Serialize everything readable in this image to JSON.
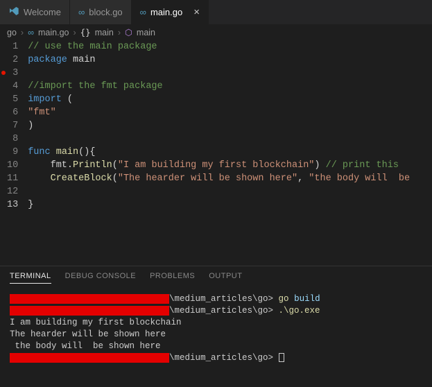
{
  "tabs": [
    {
      "label": "Welcome",
      "type": "vs"
    },
    {
      "label": "block.go",
      "type": "go"
    },
    {
      "label": "main.go",
      "type": "go",
      "active": true,
      "closable": true
    }
  ],
  "breadcrumb": {
    "root": "go",
    "file": "main.go",
    "sym1": "main",
    "sym2": "main"
  },
  "code": {
    "lines": [
      {
        "n": 1,
        "segs": [
          {
            "cls": "c-comment",
            "t": "// use the main package"
          }
        ]
      },
      {
        "n": 2,
        "segs": [
          {
            "cls": "c-keyword",
            "t": "package"
          },
          {
            "cls": "c-ident",
            "t": " main"
          }
        ]
      },
      {
        "n": 3,
        "segs": [],
        "bp": true
      },
      {
        "n": 4,
        "segs": [
          {
            "cls": "c-comment",
            "t": "//import the fmt package"
          }
        ]
      },
      {
        "n": 5,
        "segs": [
          {
            "cls": "c-keyword",
            "t": "import"
          },
          {
            "cls": "c-punct",
            "t": " ("
          }
        ]
      },
      {
        "n": 6,
        "segs": [
          {
            "cls": "c-string",
            "t": "\"fmt\""
          }
        ]
      },
      {
        "n": 7,
        "segs": [
          {
            "cls": "c-punct",
            "t": ")"
          }
        ]
      },
      {
        "n": 8,
        "segs": []
      },
      {
        "n": 9,
        "segs": [
          {
            "cls": "c-keyword",
            "t": "func"
          },
          {
            "cls": "c-ident",
            "t": " "
          },
          {
            "cls": "c-func",
            "t": "main"
          },
          {
            "cls": "c-punct",
            "t": "(){"
          }
        ]
      },
      {
        "n": 10,
        "segs": [
          {
            "cls": "c-ident",
            "t": "    fmt"
          },
          {
            "cls": "c-punct",
            "t": "."
          },
          {
            "cls": "c-func",
            "t": "Println"
          },
          {
            "cls": "c-punct",
            "t": "("
          },
          {
            "cls": "c-string",
            "t": "\"I am building my first blockchain\""
          },
          {
            "cls": "c-punct",
            "t": ") "
          },
          {
            "cls": "c-comment",
            "t": "// print this"
          }
        ]
      },
      {
        "n": 11,
        "segs": [
          {
            "cls": "c-ident",
            "t": "    "
          },
          {
            "cls": "c-func",
            "t": "CreateBlock"
          },
          {
            "cls": "c-punct",
            "t": "("
          },
          {
            "cls": "c-string",
            "t": "\"The hearder will be shown here\""
          },
          {
            "cls": "c-punct",
            "t": ", "
          },
          {
            "cls": "c-string",
            "t": "\"the body will  be "
          }
        ]
      },
      {
        "n": 12,
        "segs": []
      },
      {
        "n": 13,
        "segs": [
          {
            "cls": "c-punct",
            "t": "}"
          }
        ],
        "current": true
      }
    ]
  },
  "panel": {
    "tabs": [
      "TERMINAL",
      "DEBUG CONSOLE",
      "PROBLEMS",
      "OUTPUT"
    ],
    "active": 0
  },
  "terminal": {
    "path_suffix": "\\medium_articles\\go>",
    "cmd1_a": "go",
    "cmd1_b": "build",
    "cmd2": ".\\go.exe",
    "out1": "I am building my first blockchain",
    "out2": "The hearder will be shown here",
    "out3": " the body will  be shown here"
  }
}
